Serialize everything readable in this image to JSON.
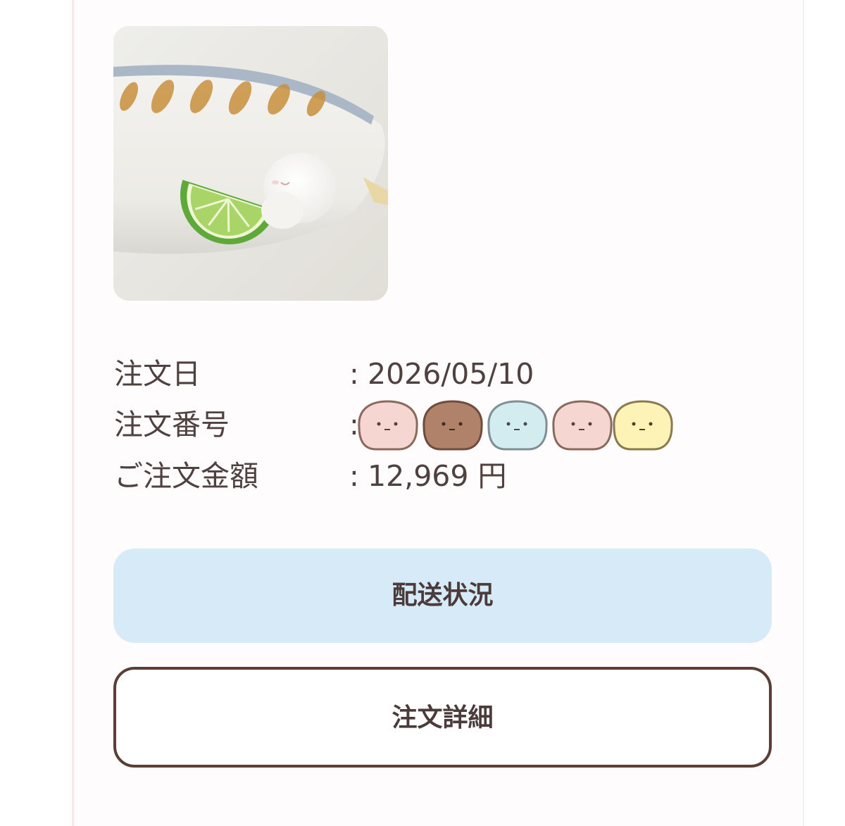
{
  "order": {
    "image_alt": "product photo: fish plush with lime slice",
    "date_label": "注文日",
    "date_value": "2026/05/10",
    "number_label": "注文番号",
    "number_value_masked": "redacted with character stickers",
    "amount_label": "ご注文金額",
    "amount_value": "12,969 円",
    "colon": ":"
  },
  "buttons": {
    "shipping_label": "配送状況",
    "detail_label": "注文詳細"
  },
  "colors": {
    "card_border": "#fbe6ea",
    "shipping_button_bg": "#d6eaf8",
    "detail_button_border": "#5a3f37",
    "text": "#4f4140"
  },
  "icons": {
    "mask_stickers": [
      "pink-blob-icon",
      "brown-blob-icon",
      "lightblue-blob-icon",
      "pink-blob-icon",
      "yellow-blob-icon"
    ]
  }
}
